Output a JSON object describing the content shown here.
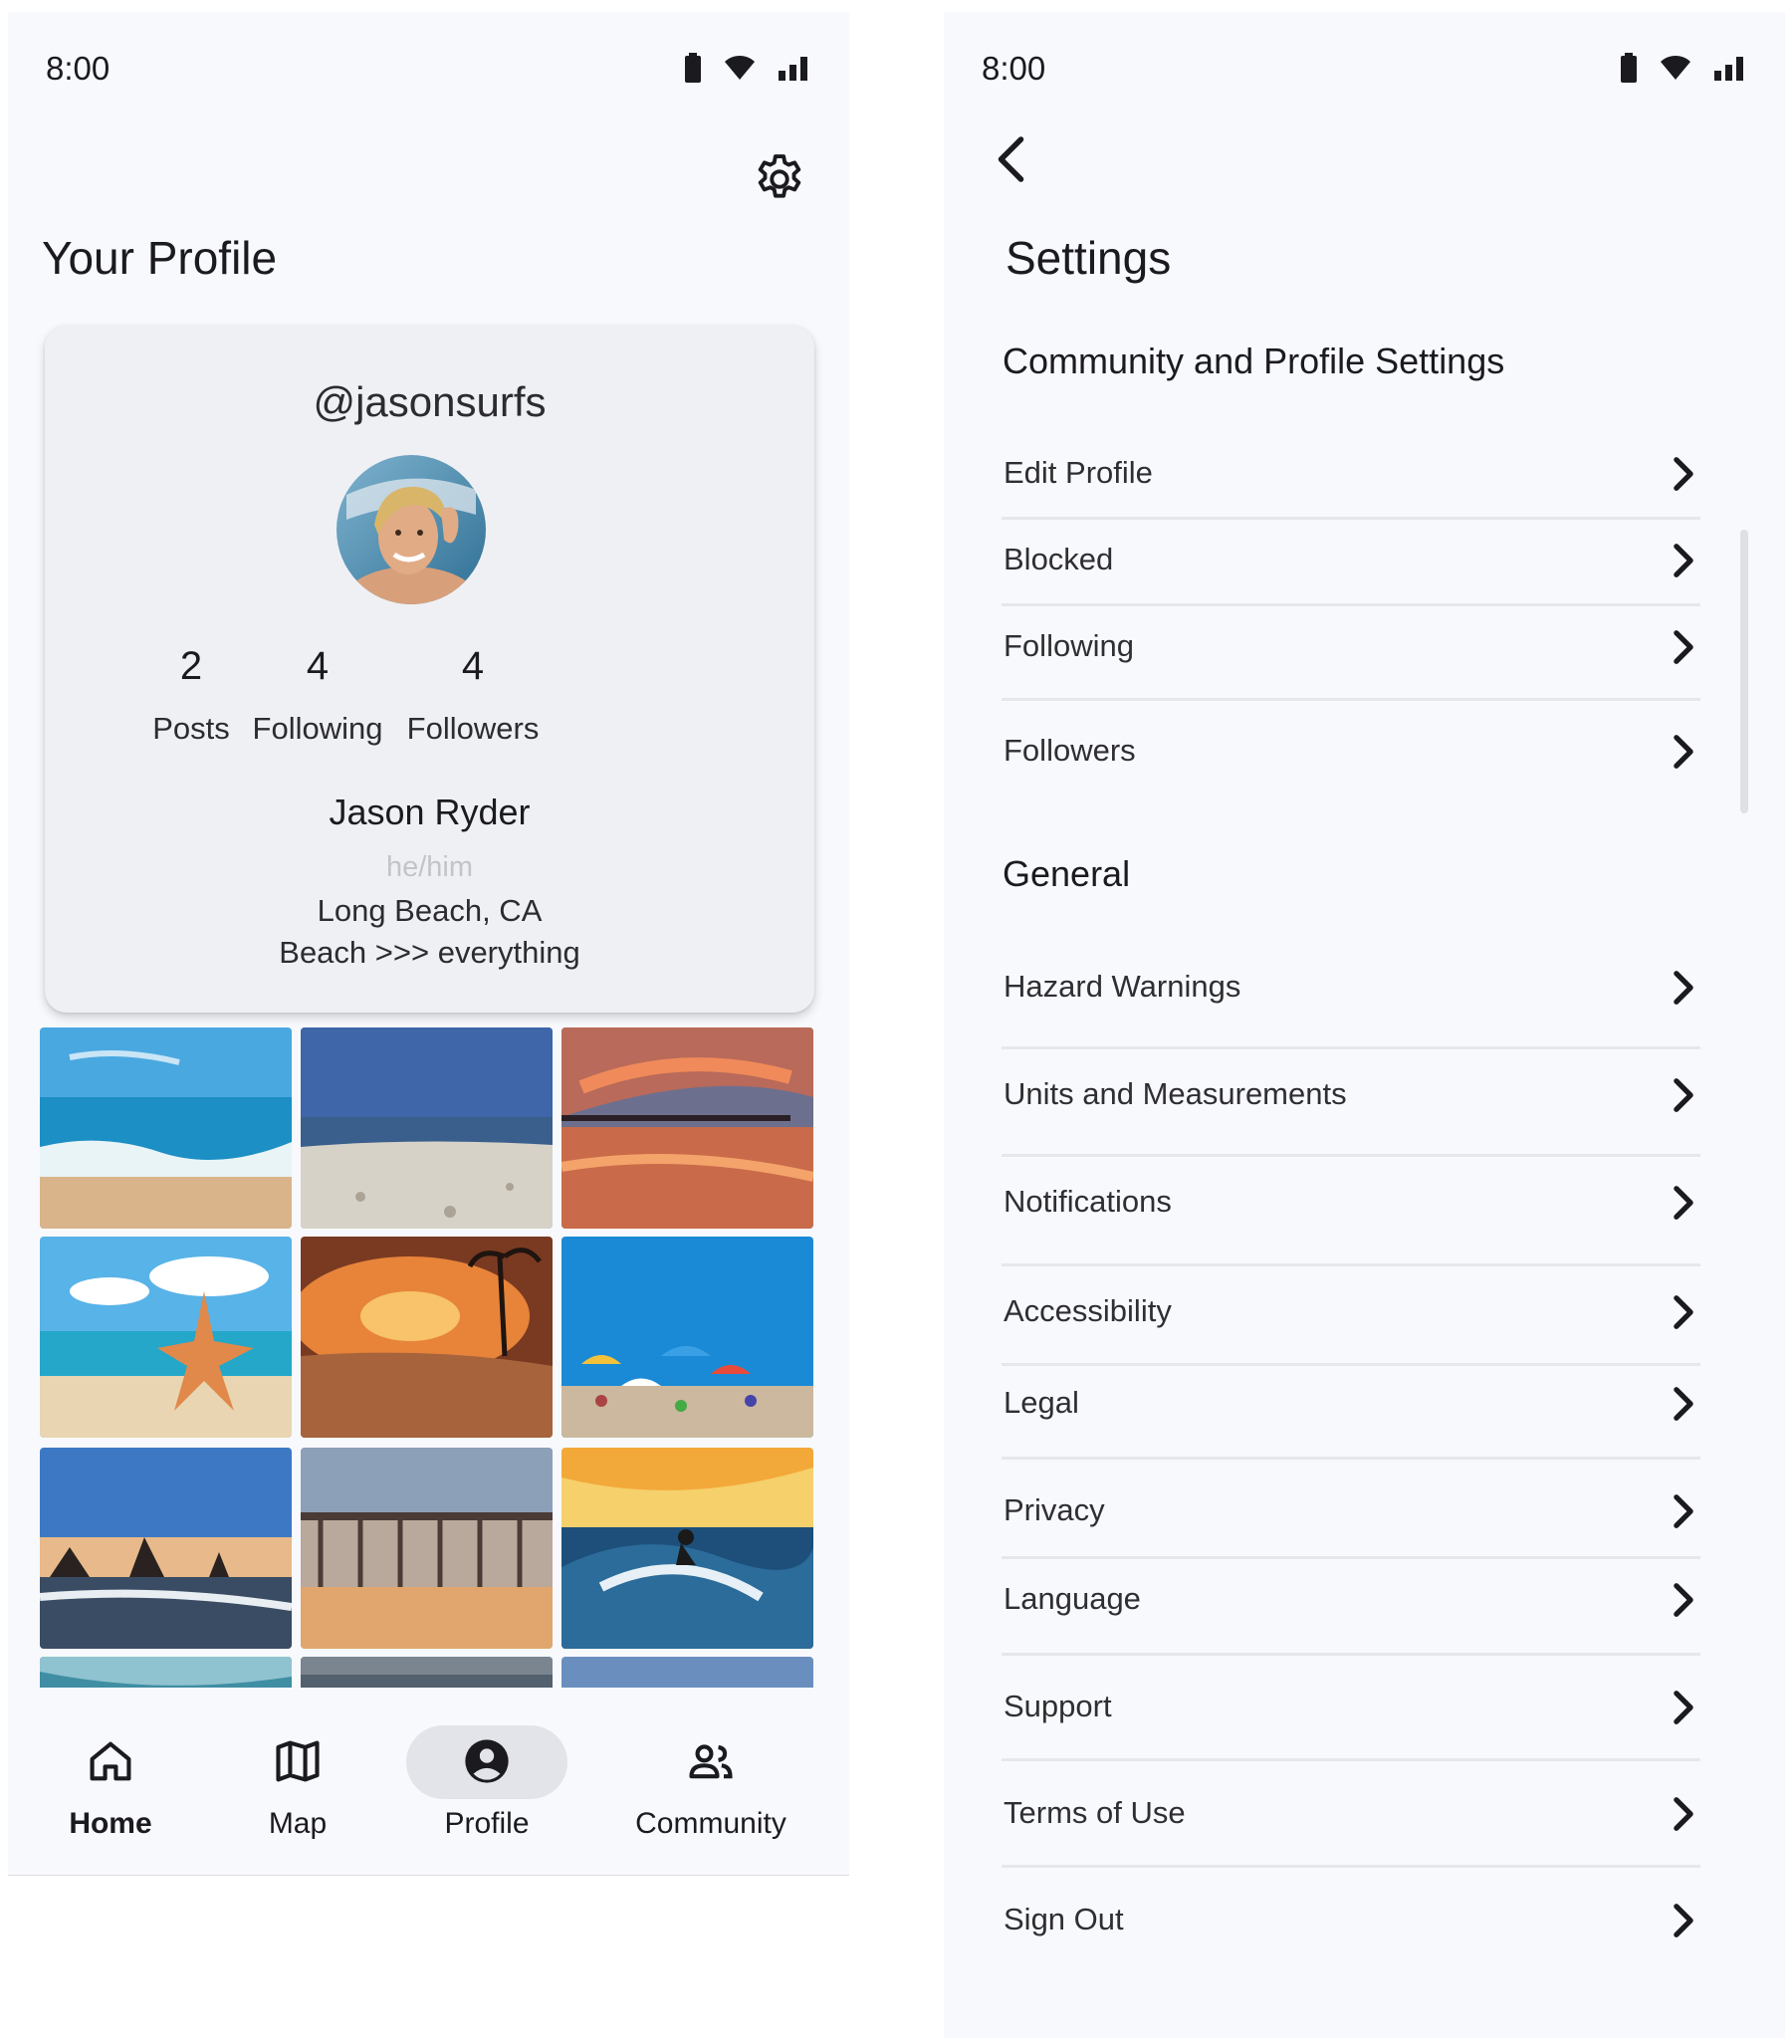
{
  "status_bar": {
    "time": "8:00",
    "icons": [
      "battery-icon",
      "wifi-icon",
      "signal-icon"
    ]
  },
  "profile_screen": {
    "title": "Your Profile",
    "settings_icon": "gear-icon",
    "card": {
      "handle": "@jasonsurfs",
      "stats": [
        {
          "value": "2",
          "label": "Posts"
        },
        {
          "value": "4",
          "label": "Following"
        },
        {
          "value": "4",
          "label": "Followers"
        }
      ],
      "name": "Jason Ryder",
      "pronouns": "he/him",
      "location": "Long Beach, CA",
      "bio": "Beach >>> everything"
    },
    "nav": [
      {
        "label": "Home",
        "icon": "home-icon",
        "active": false
      },
      {
        "label": "Map",
        "icon": "map-icon",
        "active": false
      },
      {
        "label": "Profile",
        "icon": "account-circle-icon",
        "active": true
      },
      {
        "label": "Community",
        "icon": "people-icon",
        "active": false
      }
    ]
  },
  "settings_screen": {
    "title": "Settings",
    "back_icon": "chevron-left-icon",
    "sections": [
      {
        "heading": "Community and Profile Settings",
        "items": [
          "Edit Profile",
          "Blocked",
          "Following",
          "Followers"
        ]
      },
      {
        "heading": "General",
        "items": [
          "Hazard Warnings",
          "Units and Measurements",
          "Notifications",
          "Accessibility",
          "Legal",
          "Privacy",
          "Language",
          "Support",
          "Terms of Use",
          "Sign Out"
        ]
      }
    ]
  },
  "colors": {
    "background": "#f8f9fc",
    "card": "#eff0f4",
    "nav_pill": "#e3e4e9",
    "text": "#1b1b1f",
    "muted_text": "#c3c3c8"
  }
}
